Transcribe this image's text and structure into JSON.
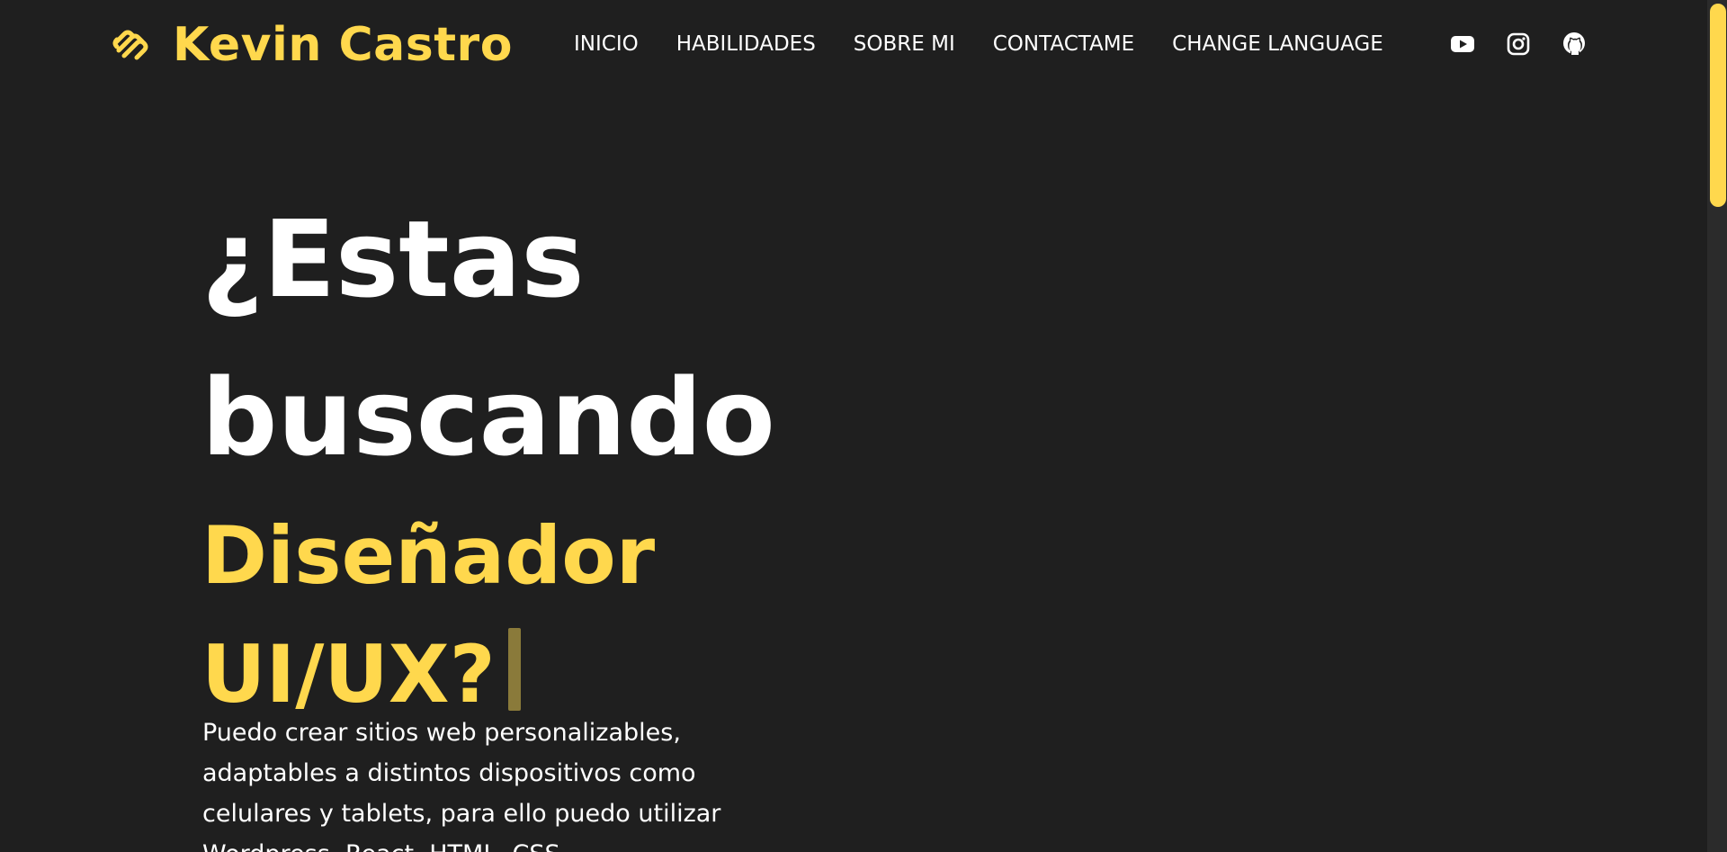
{
  "header": {
    "brand_name": "Kevin Castro",
    "brand_icon": "brand-logo-icon",
    "nav": [
      {
        "label": "INICIO"
      },
      {
        "label": "HABILIDADES"
      },
      {
        "label": "SOBRE MI"
      },
      {
        "label": "CONTACTAME"
      },
      {
        "label": "CHANGE LANGUAGE"
      }
    ],
    "social": [
      {
        "icon": "youtube-icon"
      },
      {
        "icon": "instagram-icon"
      },
      {
        "icon": "github-icon"
      }
    ]
  },
  "hero": {
    "line1": "¿Estas",
    "line2": "buscando",
    "accent1": "Diseñador",
    "accent2": "UI/UX?",
    "description": "Puedo crear sitios web personalizables, adaptables a distintos dispositivos como celulares y tablets, para ello puedo utilizar Wordpress, React, HTML, CSS"
  },
  "colors": {
    "background": "#1f1f1f",
    "accent": "#ffd84d",
    "text": "#ffffff"
  }
}
